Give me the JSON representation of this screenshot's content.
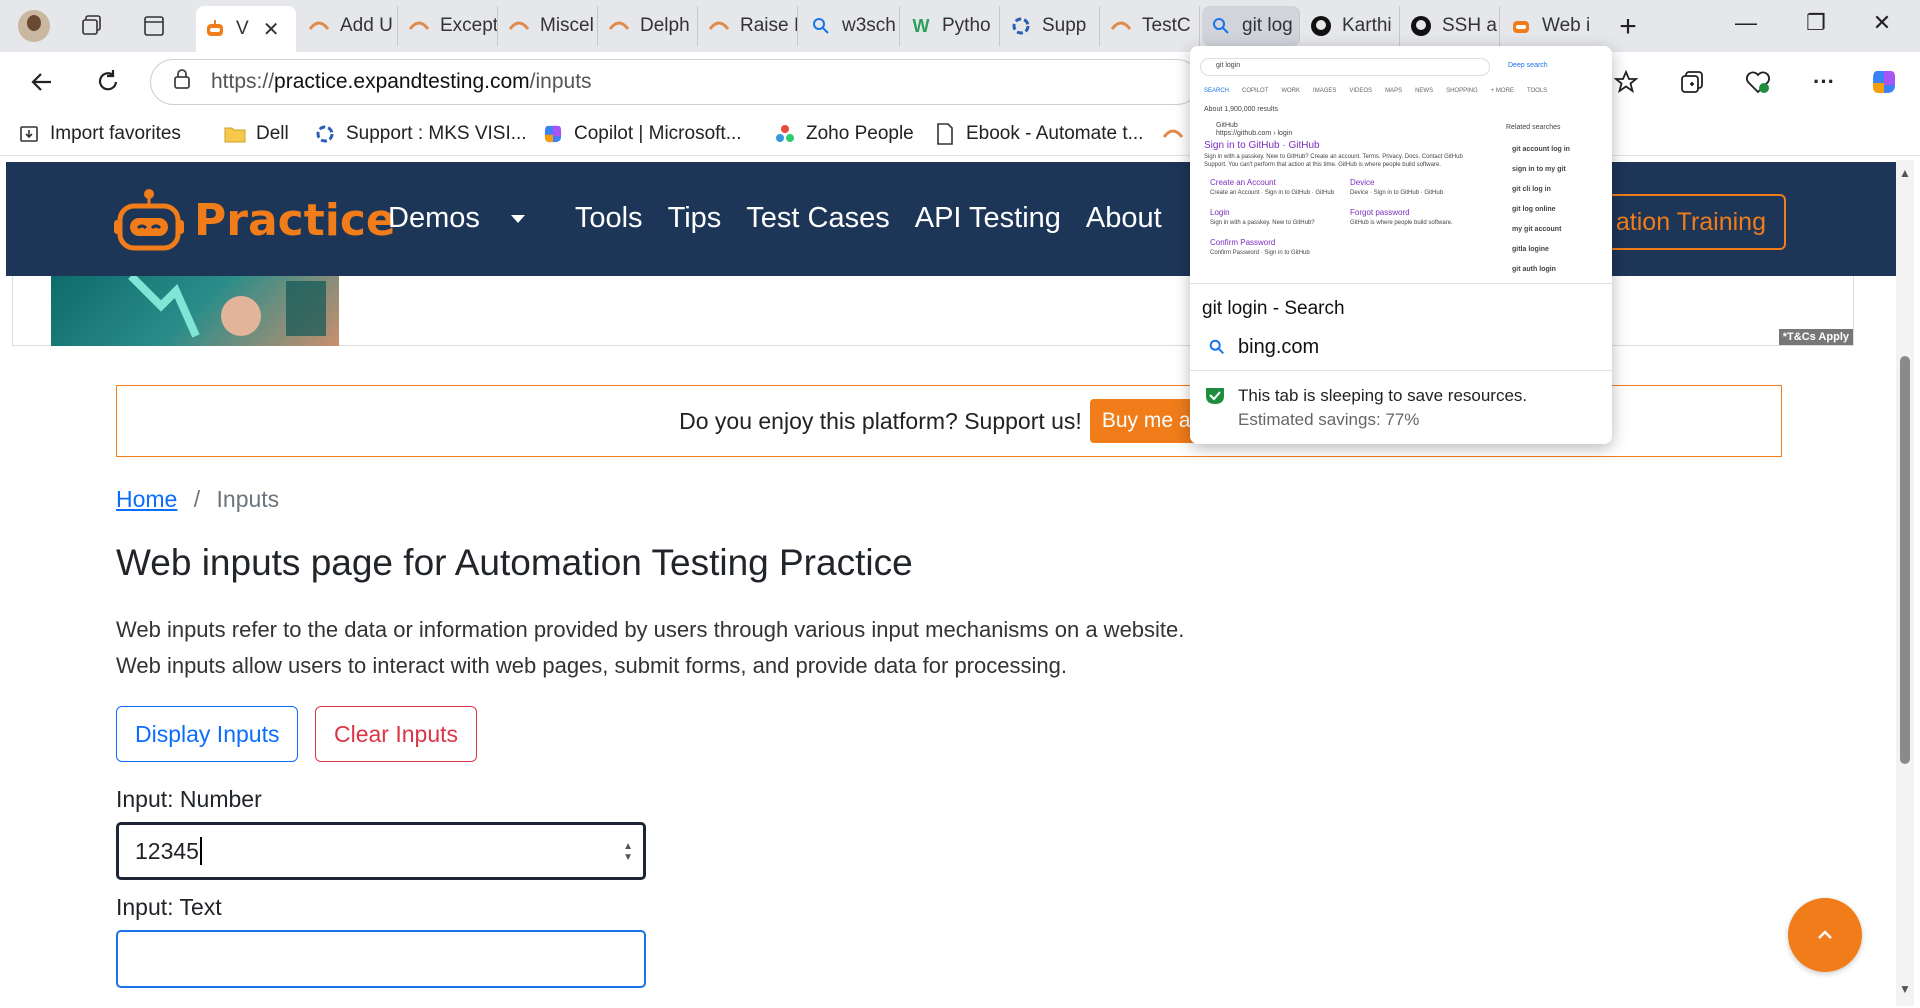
{
  "browser": {
    "tabs": [
      {
        "label": "V",
        "icon": "practice-robot-icon",
        "active": true
      },
      {
        "label": "Add U",
        "icon": "practice-robot-icon"
      },
      {
        "label": "Except",
        "icon": "practice-robot-icon"
      },
      {
        "label": "Miscel",
        "icon": "practice-robot-icon"
      },
      {
        "label": "Delph",
        "icon": "practice-robot-icon"
      },
      {
        "label": "Raise I",
        "icon": "practice-robot-icon"
      },
      {
        "label": "w3sch",
        "icon": "search-icon"
      },
      {
        "label": "Pytho",
        "icon": "w-logo-icon"
      },
      {
        "label": "Supp",
        "icon": "support-swirl-icon"
      },
      {
        "label": "TestC",
        "icon": "practice-robot-icon"
      },
      {
        "label": "git log",
        "icon": "search-icon",
        "hover": true
      },
      {
        "label": "Karthi",
        "icon": "github-icon"
      },
      {
        "label": "SSH a",
        "icon": "github-icon"
      },
      {
        "label": "Web i",
        "icon": "practice-robot-icon"
      }
    ],
    "active_tab_close": "✕",
    "new_tab": "+",
    "window_controls": {
      "minimize": "—",
      "restore": "❐",
      "close": "✕"
    },
    "address": {
      "scheme": "https://",
      "host": "practice.expandtesting.com",
      "path": "/inputs"
    },
    "favorites": [
      {
        "label": "Import favorites",
        "icon": "import-icon"
      },
      {
        "label": "Dell",
        "icon": "folder-icon"
      },
      {
        "label": "Support : MKS VISI...",
        "icon": "support-swirl-icon"
      },
      {
        "label": "Copilot | Microsoft...",
        "icon": "copilot-icon"
      },
      {
        "label": "Zoho People",
        "icon": "zoho-icon"
      },
      {
        "label": "Ebook - Automate t...",
        "icon": "document-icon"
      }
    ],
    "colors": {
      "accent": "#0d6efd",
      "brand_orange": "#f07c1a",
      "site_nav": "#1d3557"
    }
  },
  "site": {
    "logo_text": "Practice",
    "menu": [
      "Demos",
      "Tools",
      "Tips",
      "Test Cases",
      "API Testing",
      "About"
    ],
    "training_button": "ation Training",
    "ad_badge": "*T&Cs Apply",
    "support_text": "Do you enjoy this platform? Support us!",
    "support_button": "Buy me a c",
    "breadcrumb": {
      "home": "Home",
      "separator": "/",
      "current": "Inputs"
    },
    "title": "Web inputs page for Automation Testing Practice",
    "description": [
      "Web inputs refer to the data or information provided by users through various input mechanisms on a website.",
      "Web inputs allow users to interact with web pages, submit forms, and provide data for processing."
    ],
    "buttons": {
      "display": "Display Inputs",
      "clear": "Clear Inputs"
    },
    "fields": [
      {
        "label": "Input: Number",
        "value": "12345"
      },
      {
        "label": "Input: Text",
        "value": ""
      }
    ]
  },
  "tab_preview": {
    "title": "git login - Search",
    "domain": "bing.com",
    "sleep_text": "This tab is sleeping to save resources.",
    "savings_text": "Estimated savings: 77%",
    "thumb": {
      "query": "git login",
      "deep_search": "Deep search",
      "nav": [
        "SEARCH",
        "COPILOT",
        "WORK",
        "IMAGES",
        "VIDEOS",
        "MAPS",
        "NEWS",
        "SHOPPING",
        "+ MORE",
        "TOOLS"
      ],
      "results_count": "About 1,900,000 results",
      "site": "GitHub",
      "site_url": "https://github.com › login",
      "main_link": "Sign in to GitHub · GitHub",
      "snippet1": "Sign in with a passkey. New to GitHub? Create an account. Terms. Privacy. Docs. Contact GitHub",
      "snippet2": "Support. You can't perform that action at this time. GitHub is where people build software.",
      "sub_links": [
        {
          "title": "Create an Account",
          "text": "Create an Account · Sign in to GitHub · GitHub"
        },
        {
          "title": "Device",
          "text": "Device · Sign in to GitHub · GitHub"
        },
        {
          "title": "Login",
          "text": "Sign in with a passkey. New to GitHub?"
        },
        {
          "title": "Forgot password",
          "text": "GitHub is where people build software."
        },
        {
          "title": "Confirm Password",
          "text": "Confirm Password · Sign in to GitHub"
        }
      ],
      "related_title": "Related searches",
      "related": [
        "git account log in",
        "sign in to my git",
        "git cli log in",
        "git log online",
        "my git account",
        "gitla logine",
        "git auth login"
      ]
    }
  }
}
